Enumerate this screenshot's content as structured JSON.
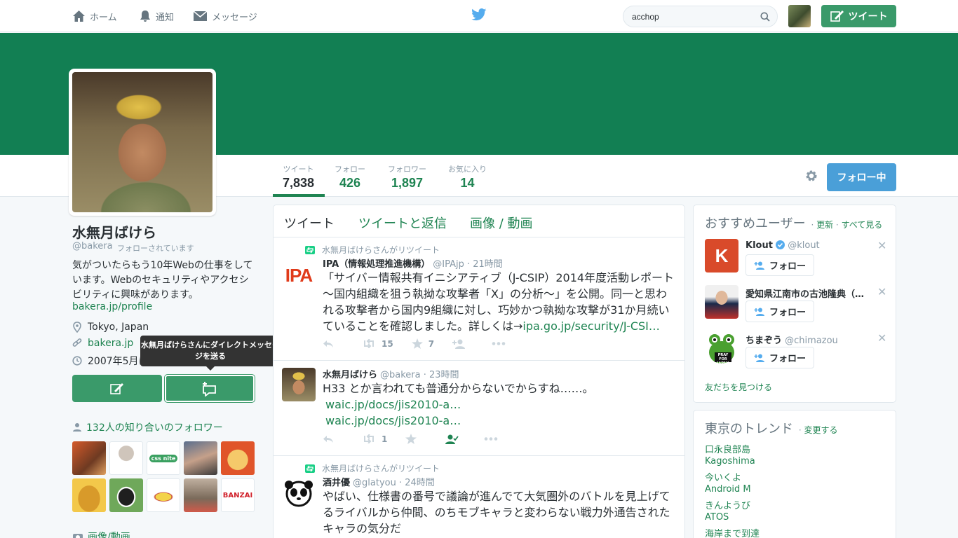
{
  "topnav": {
    "home": "ホーム",
    "notifications": "通知",
    "messages": "メッセージ",
    "search_value": "acchop",
    "tweet_button": "ツイート"
  },
  "profile": {
    "name": "水無月ばけら",
    "handle": "@bakera",
    "follows_you": "フォローされています",
    "bio": "気がついたらもう10年Webの仕事をしています。Webのセキュリティやアクセシビリティに興味があります。",
    "profile_link": "bakera.jp/profile",
    "location": "Tokyo, Japan",
    "website": "bakera.jp",
    "joined": "2007年5月に登録",
    "dm_tooltip": "水無月ばけらさんにダイレクトメッセージを送る",
    "followers_you_know": "132人の知り合いのフォロワー",
    "media": "画像/動画"
  },
  "stats": [
    {
      "label": "ツイート",
      "value": "7,838"
    },
    {
      "label": "フォロー",
      "value": "426"
    },
    {
      "label": "フォロワー",
      "value": "1,897"
    },
    {
      "label": "お気に入り",
      "value": "14"
    }
  ],
  "following_button": "フォロー中",
  "timeline": {
    "tabs": [
      "ツイート",
      "ツイートと返信",
      "画像 / 動画"
    ],
    "tweets": [
      {
        "retweeted_by": "水無月ばけらさんがリツイート",
        "name": "IPA（情報処理推進機構）",
        "meta": "@IPAjp · 21時間",
        "avatar_text": "IPA",
        "text": "「サイバー情報共有イニシアティブ（J-CSIP）2014年度活動レポート～国内組織を狙う執拗な攻撃者「X」の分析～」を公開。同一と思われる攻撃者から国内9組織に対し、巧妙かつ執拗な攻撃が31か月続いていることを確認しました。詳しくは→",
        "link": "ipa.go.jp/security/J-CSI…",
        "retweets": "15",
        "favorites": "7"
      },
      {
        "name": "水無月ばけら",
        "meta": "@bakera · 23時間",
        "text": "H33 とか言われても普通分からないでからすね……。",
        "link1": "waic.jp/docs/jis2010-a…",
        "link2": "waic.jp/docs/jis2010-a…",
        "retweets": "1"
      },
      {
        "retweeted_by": "水無月ばけらさんがリツイート",
        "name": "酒井優",
        "meta": "@glatyou · 24時間",
        "text": "やばい、仕様書の番号で議論が進んでて大気圏外のバトルを見上げてるライバルから仲間、のちモブキャラと変わらない戦力外通告されたキャラの気分だ"
      }
    ]
  },
  "suggestions": {
    "title": "おすすめユーザー",
    "refresh": "更新",
    "sep": " · ",
    "view_all": "すべて見る",
    "follow_label": "フォロー",
    "users": [
      {
        "name": "Klout",
        "handle": "@klout",
        "avatar_text": "K"
      },
      {
        "name": "愛知県江南市の古池隆典（…",
        "handle": ""
      },
      {
        "name": "ちまぞう",
        "handle": "@chimazou",
        "avatar_text": "PRAY FOR JAPAN"
      }
    ],
    "find_friends": "友だちを見つける"
  },
  "trends": {
    "title": "東京のトレンド",
    "change": "変更する",
    "items": [
      "口永良部島",
      "Kagoshima",
      "今いくよ",
      "Android M",
      "きんようび",
      "ATOS",
      "海岸まで到達"
    ]
  },
  "follower_thumbs": [
    "css nite",
    "BANZAI"
  ],
  "colors": {
    "brand": "#1f8452",
    "banner": "#127f53",
    "follow_button": "#4a9fd8",
    "button_green": "#3a9a6a"
  }
}
